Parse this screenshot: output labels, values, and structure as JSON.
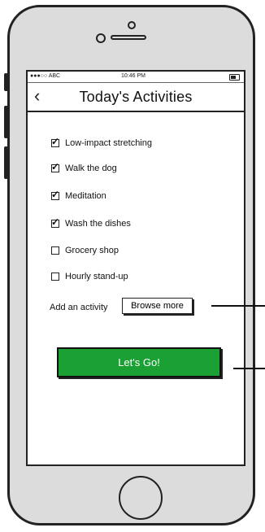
{
  "status_bar": {
    "carrier": "●●●○○ ABC",
    "time": "10:46 PM"
  },
  "header": {
    "back_icon": "‹",
    "title": "Today's Activities"
  },
  "activities": [
    {
      "label": "Low-impact stretching",
      "checked": true
    },
    {
      "label": "Walk the dog",
      "checked": true
    },
    {
      "label": "Meditation",
      "checked": true
    },
    {
      "label": "Wash the dishes",
      "checked": true
    },
    {
      "label": "Grocery shop",
      "checked": false
    },
    {
      "label": "Hourly stand-up",
      "checked": false
    }
  ],
  "add_activity": {
    "label": "Add an activity",
    "browse_label": "Browse more"
  },
  "cta": {
    "label": "Let's Go!",
    "color": "#1aa033"
  }
}
